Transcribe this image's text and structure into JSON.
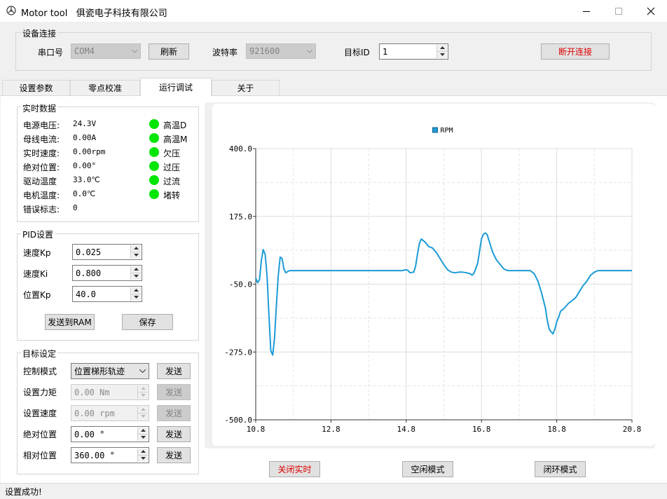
{
  "window": {
    "title": "Motor tool   俱瓷电子科技有限公司",
    "icon": "motor-logo-icon"
  },
  "connection": {
    "group_title": "设备连接",
    "port_label": "串口号",
    "port_value": "COM4",
    "refresh_label": "刷新",
    "baud_label": "波特率",
    "baud_value": "921600",
    "target_id_label": "目标ID",
    "target_id_value": "1",
    "disconnect_label": "断开连接"
  },
  "tabs": [
    "设置参数",
    "零点校准",
    "运行调试",
    "关于"
  ],
  "active_tab": 2,
  "realtime": {
    "group_title": "实时数据",
    "rows": [
      {
        "label": "电源电压:",
        "value": "24.3V"
      },
      {
        "label": "母线电流:",
        "value": "0.00A"
      },
      {
        "label": "实时速度:",
        "value": "0.00rpm"
      },
      {
        "label": "绝对位置:",
        "value": "0.00°"
      },
      {
        "label": "驱动温度",
        "value": "33.0℃"
      },
      {
        "label": "电机温度:",
        "value": "0.0℃"
      },
      {
        "label": "错误标志:",
        "value": "0"
      }
    ],
    "indicators": [
      {
        "label": "高温D",
        "color": "#00e600"
      },
      {
        "label": "高温M",
        "color": "#00e600"
      },
      {
        "label": "欠压",
        "color": "#00e600"
      },
      {
        "label": "过压",
        "color": "#00e600"
      },
      {
        "label": "过流",
        "color": "#00e600"
      },
      {
        "label": "堵转",
        "color": "#00e600"
      }
    ]
  },
  "pid": {
    "group_title": "PID设置",
    "rows": [
      {
        "label": "速度Kp",
        "value": "0.025"
      },
      {
        "label": "速度Ki",
        "value": "0.800"
      },
      {
        "label": "位置Kp",
        "value": "40.0"
      }
    ],
    "send_label": "发送到RAM",
    "save_label": "保存"
  },
  "target": {
    "group_title": "目标设定",
    "mode_label": "控制模式",
    "mode_value": "位置梯形轨迹",
    "send_label": "发送",
    "rows": [
      {
        "label": "设置力矩",
        "value": "0.00 Nm",
        "enabled": false
      },
      {
        "label": "设置速度",
        "value": "0.00 rpm",
        "enabled": false
      },
      {
        "label": "绝对位置",
        "value": "0.00 °",
        "enabled": true
      },
      {
        "label": "相对位置",
        "value": "360.00 °",
        "enabled": true
      }
    ]
  },
  "bottom_buttons": {
    "realtime_off": "关闭实时",
    "idle_mode": "空闲模式",
    "closed_loop": "闭环模式"
  },
  "status": "设置成功!",
  "colors": {
    "series": "#1a9bd7",
    "led_ok": "#00e600",
    "warn_text": "#e00000"
  },
  "chart_data": {
    "type": "line",
    "legend": [
      "RPM"
    ],
    "legend_position": "top-center",
    "xlim": [
      10.8,
      20.8
    ],
    "ylim": [
      -500.0,
      400.0
    ],
    "x_ticks": [
      "10.8",
      "12.8",
      "14.8",
      "16.8",
      "18.8",
      "20.8"
    ],
    "y_ticks": [
      "400.0",
      "175.0",
      "-50.0",
      "-275.0",
      "-500.0"
    ],
    "grid": true,
    "series": [
      {
        "name": "RPM",
        "x": [
          10.8,
          10.85,
          10.9,
          10.95,
          11.0,
          11.05,
          11.1,
          11.15,
          11.2,
          11.25,
          11.3,
          11.35,
          11.4,
          11.45,
          11.5,
          11.55,
          11.6,
          11.65,
          11.7,
          11.75,
          11.8,
          11.85,
          11.9,
          11.95,
          12.0,
          12.1,
          12.2,
          12.4,
          12.8,
          13.2,
          13.6,
          14.0,
          14.2,
          14.4,
          14.5,
          14.6,
          14.65,
          14.7,
          14.75,
          14.8,
          14.85,
          14.9,
          15.0,
          15.05,
          15.1,
          15.15,
          15.2,
          15.3,
          15.4,
          15.5,
          15.6,
          15.7,
          15.8,
          15.9,
          16.0,
          16.1,
          16.2,
          16.3,
          16.4,
          16.5,
          16.55,
          16.6,
          16.7,
          16.75,
          16.8,
          16.85,
          16.9,
          16.95,
          17.0,
          17.05,
          17.1,
          17.2,
          17.3,
          17.4,
          17.5,
          17.6,
          17.7,
          17.8,
          17.9,
          18.0,
          18.1,
          18.2,
          18.3,
          18.4,
          18.5,
          18.55,
          18.6,
          18.7,
          18.75,
          18.8,
          18.85,
          18.9,
          19.0,
          19.1,
          19.2,
          19.3,
          19.4,
          19.5,
          19.6,
          19.7,
          19.8,
          19.9,
          20.0,
          20.1,
          20.2,
          20.4,
          20.6,
          20.8
        ],
        "y": [
          -30,
          -45,
          -35,
          30,
          65,
          50,
          -20,
          -150,
          -270,
          -285,
          -230,
          -120,
          -20,
          40,
          35,
          0,
          -12,
          -8,
          -5,
          -5,
          -5,
          -5,
          -5,
          -5,
          -5,
          -5,
          -5,
          -5,
          -5,
          -5,
          -5,
          -5,
          -5,
          -5,
          -5,
          -5,
          -5,
          -5,
          -3,
          -2,
          -5,
          -12,
          -10,
          10,
          50,
          85,
          100,
          90,
          75,
          70,
          55,
          35,
          15,
          -2,
          -10,
          -12,
          -10,
          -10,
          -12,
          -15,
          -20,
          -14,
          20,
          60,
          100,
          115,
          120,
          115,
          95,
          75,
          55,
          30,
          15,
          0,
          -5,
          -5,
          -5,
          -5,
          -5,
          -5,
          -5,
          -15,
          -40,
          -80,
          -130,
          -170,
          -200,
          -215,
          -200,
          -175,
          -160,
          -140,
          -130,
          -115,
          -105,
          -95,
          -75,
          -55,
          -40,
          -20,
          -10,
          -5,
          -5,
          -5,
          -5,
          -5,
          -5,
          -5
        ]
      }
    ]
  }
}
